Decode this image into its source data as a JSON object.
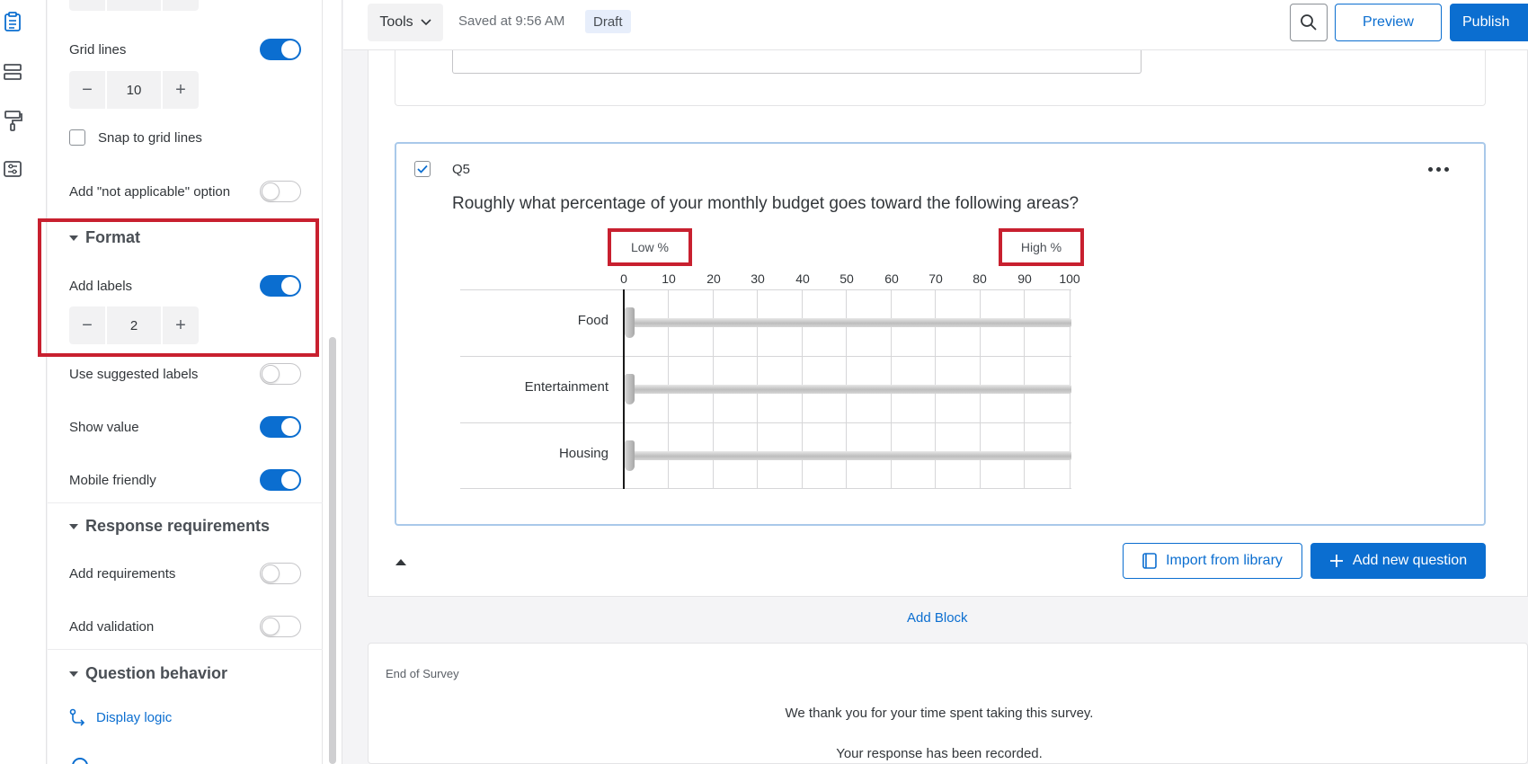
{
  "topbar": {
    "tools_label": "Tools",
    "saved_text": "Saved at 9:56 AM",
    "status_badge": "Draft",
    "preview_label": "Preview",
    "publish_label": "Publish"
  },
  "panel": {
    "grid_lines_label": "Grid lines",
    "grid_lines_on": true,
    "grid_lines_value": "10",
    "snap_label": "Snap to grid lines",
    "not_applicable_label": "Add \"not applicable\" option",
    "format_section": "Format",
    "add_labels_label": "Add labels",
    "labels_count": "2",
    "suggested_labels_label": "Use suggested labels",
    "show_value_label": "Show value",
    "mobile_friendly_label": "Mobile friendly",
    "response_section": "Response requirements",
    "add_requirements_label": "Add requirements",
    "add_validation_label": "Add validation",
    "behavior_section": "Question behavior",
    "display_logic_label": "Display logic"
  },
  "question": {
    "number": "Q5",
    "text": "Roughly what percentage of your monthly budget goes toward the following areas?",
    "labels": [
      "Low %",
      "High %"
    ],
    "ticks": [
      "0",
      "10",
      "20",
      "30",
      "40",
      "50",
      "60",
      "70",
      "80",
      "90",
      "100"
    ],
    "statements": [
      "Food",
      "Entertainment",
      "Housing"
    ]
  },
  "actions": {
    "import_label": "Import from library",
    "add_question_label": "Add new question",
    "add_block_label": "Add Block"
  },
  "end_of_survey": {
    "title": "End of Survey",
    "message_1": "We thank you for your time spent taking this survey.",
    "message_2": "Your response has been recorded."
  },
  "colors": {
    "accent": "#0b6ed0",
    "highlight": "#c8202f"
  }
}
